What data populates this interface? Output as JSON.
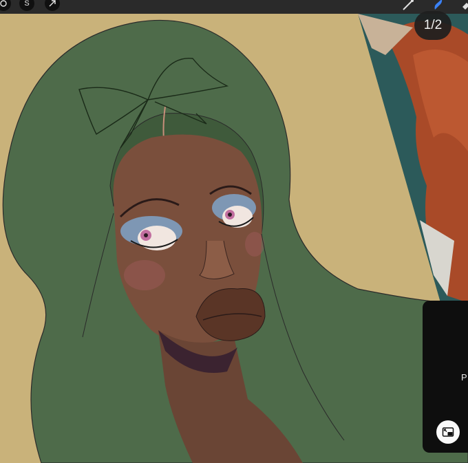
{
  "toolbar": {
    "left_tools": [
      {
        "icon": "actions-icon"
      },
      {
        "icon": "selection-s-icon",
        "label": "S"
      },
      {
        "icon": "transform-arrow-icon"
      }
    ],
    "right_tools": [
      {
        "icon": "brush-icon"
      },
      {
        "icon": "smudge-icon",
        "active": true
      },
      {
        "icon": "eraser-icon"
      }
    ],
    "accent_color": "#3b82f6"
  },
  "page_indicator": "1/2",
  "side_panel": {
    "partial_text": "P",
    "button_icon": "picture-in-picture-icon"
  },
  "canvas": {
    "background_color": "#c9b27a",
    "hood_color": "#4e6b4a",
    "skin_color": "#7a4f3c",
    "eyeshadow_color": "#7fa3c9",
    "reference_hair_color": "#a94a28"
  }
}
